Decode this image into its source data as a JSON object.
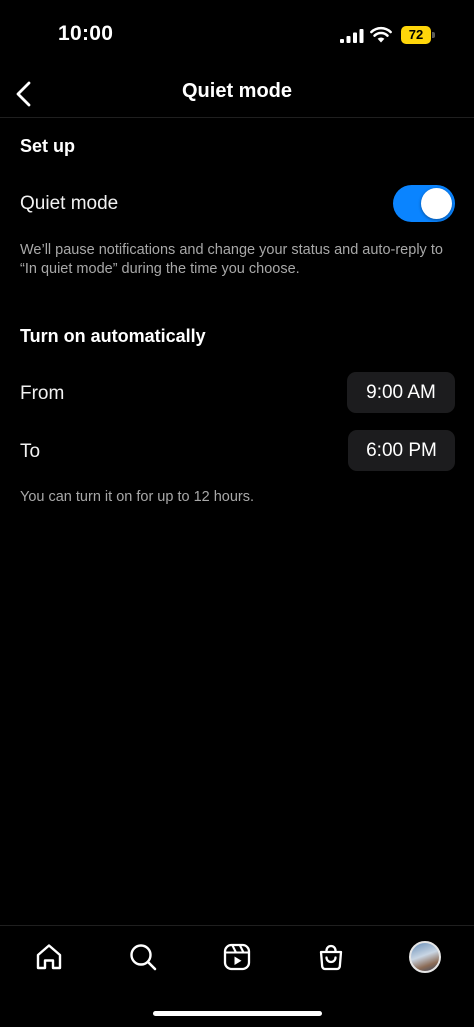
{
  "status_bar": {
    "time": "10:00",
    "battery_level": "72"
  },
  "header": {
    "title": "Quiet mode",
    "back_icon": "chevron-left-icon"
  },
  "setup": {
    "heading": "Set up",
    "toggle_label": "Quiet mode",
    "toggle_on": true,
    "description": "We’ll pause notifications and change your status and auto-reply to “In quiet mode” during the time you choose."
  },
  "schedule": {
    "heading": "Turn on automatically",
    "from_label": "From",
    "from_value": "9:00 AM",
    "to_label": "To",
    "to_value": "6:00 PM",
    "note": "You can turn it on for up to 12 hours."
  },
  "tab_bar": {
    "items": [
      "home-icon",
      "search-icon",
      "reels-icon",
      "shop-icon",
      "profile-avatar"
    ]
  },
  "colors": {
    "accent": "#0a84ff",
    "battery": "#ffd60a",
    "background": "#000000",
    "pill": "#1c1c1e"
  }
}
